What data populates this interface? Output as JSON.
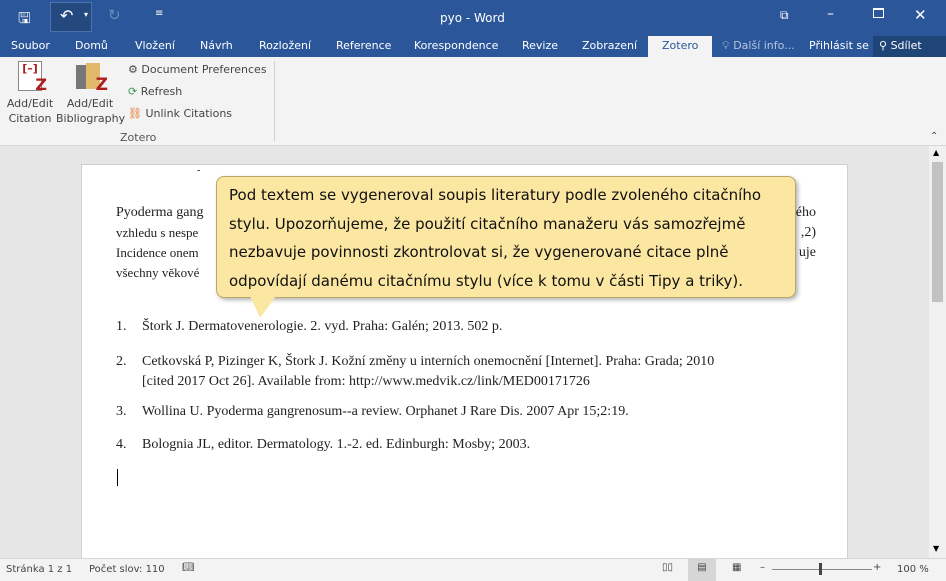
{
  "window": {
    "title": "pyo - Word"
  },
  "tabs": [
    "Soubor",
    "Domů",
    "Vložení",
    "Návrh",
    "Rozložení",
    "Reference",
    "Korespondence",
    "Revize",
    "Zobrazení",
    "Zotero"
  ],
  "tell_me": "Další info...",
  "sign_in": "Přihlásit se",
  "share": "Sdílet",
  "ribbon": {
    "add_edit_citation": "Add/Edit Citation",
    "add_edit_bibliography": "Add/Edit Bibliography",
    "document_preferences": "Document Preferences",
    "refresh": "Refresh",
    "unlink_citations": "Unlink Citations",
    "group": "Zotero"
  },
  "document": {
    "para_left": [
      "Pyoderma gang",
      "vzhledu s nespe",
      "Incidence onem",
      "všechny věkové"
    ],
    "para_right": [
      "ého",
      ",2)",
      "uje",
      ""
    ],
    "references": [
      {
        "num": "1.",
        "text": "Štork J. Dermatovenerologie. 2. vyd. Praha: Galén; 2013. 502 p."
      },
      {
        "num": "2.",
        "text": "Cetkovská P, Pizinger K, Štork J. Kožní změny u interních onemocnění [Internet]. Praha: Grada; 2010",
        "text2": "[cited 2017 Oct 26]. Available from: http://www.medvik.cz/link/MED00171726"
      },
      {
        "num": "3.",
        "text": "Wollina U. Pyoderma gangrenosum--a review. Orphanet J Rare Dis. 2007 Apr 15;2:19."
      },
      {
        "num": "4.",
        "text": "Bolognia JL, editor. Dermatology. 1.-2. ed. Edinburgh: Mosby; 2003."
      }
    ]
  },
  "callout": "Pod textem se vygeneroval soupis literatury podle zvoleného citačního stylu. Upozorňujeme, že použití citačního manažeru vás samozřejmě nezbavuje povinnosti zkontrolovat si, že vygenerované citace plně odpovídají danému citačnímu stylu (více k tomu v části Tipy a triky).",
  "status": {
    "page": "Stránka 1 z 1",
    "words": "Počet slov: 110",
    "zoom": "100 %",
    "zoom_level": 100
  },
  "colors": {
    "accent": "#2b579a",
    "callout": "#fbe7a1"
  }
}
